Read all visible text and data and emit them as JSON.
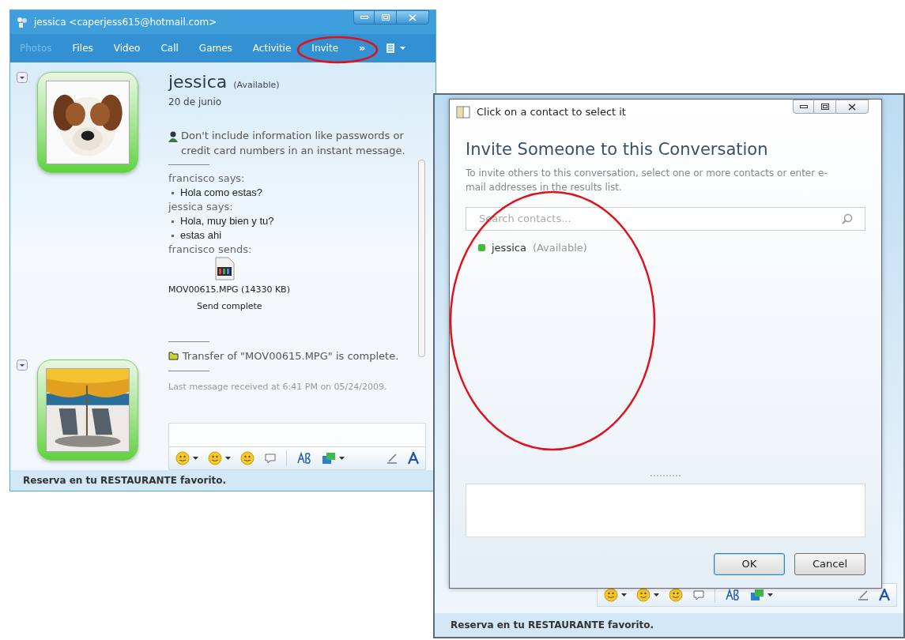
{
  "chat_window": {
    "title": "jessica <caperjess615@hotmail.com>",
    "toolbar": [
      {
        "label": "Photos",
        "disabled": true
      },
      {
        "label": "Files",
        "disabled": false
      },
      {
        "label": "Video",
        "disabled": false
      },
      {
        "label": "Call",
        "disabled": false
      },
      {
        "label": "Games",
        "disabled": false
      },
      {
        "label": "Activitie",
        "disabled": false
      },
      {
        "label": "Invite",
        "disabled": false
      }
    ],
    "more": "»",
    "contact": {
      "name": "jessica",
      "status": "(Available)",
      "personal_message": "20 de junio"
    },
    "warning": "Don't include information like passwords or credit card numbers in an instant message.",
    "messages": [
      {
        "kind": "sender",
        "text": "francisco says:"
      },
      {
        "kind": "line",
        "text": "Hola como estas?"
      },
      {
        "kind": "sender",
        "text": "jessica says:"
      },
      {
        "kind": "line",
        "text": "Hola, muy bien y tu?"
      },
      {
        "kind": "line",
        "text": "estas ahi"
      },
      {
        "kind": "sender",
        "text": "francisco sends:"
      }
    ],
    "file": {
      "name": "MOV00615.MPG (14330 KB)",
      "status": "Send complete"
    },
    "transfer_notice": "Transfer of \"MOV00615.MPG\" is complete.",
    "last_message": "Last message received at 6:41 PM on 05/24/2009.",
    "status_bar": "Reserva en tu RESTAURANTE favorito."
  },
  "second_window": {
    "status_bar": "Reserva en tu RESTAURANTE favorito."
  },
  "dialog": {
    "title": "Click on a contact to select it",
    "heading": "Invite Someone to this Conversation",
    "description": "To invite others to this conversation, select one or more contacts or enter e-mail addresses in the results list.",
    "search": {
      "placeholder": "Search contacts..."
    },
    "contacts": [
      {
        "name": "jessica",
        "status": "(Available)",
        "color": "#3fbf2a"
      }
    ],
    "buttons": [
      {
        "label": "OK",
        "default": true
      },
      {
        "label": "Cancel",
        "default": false
      }
    ]
  }
}
